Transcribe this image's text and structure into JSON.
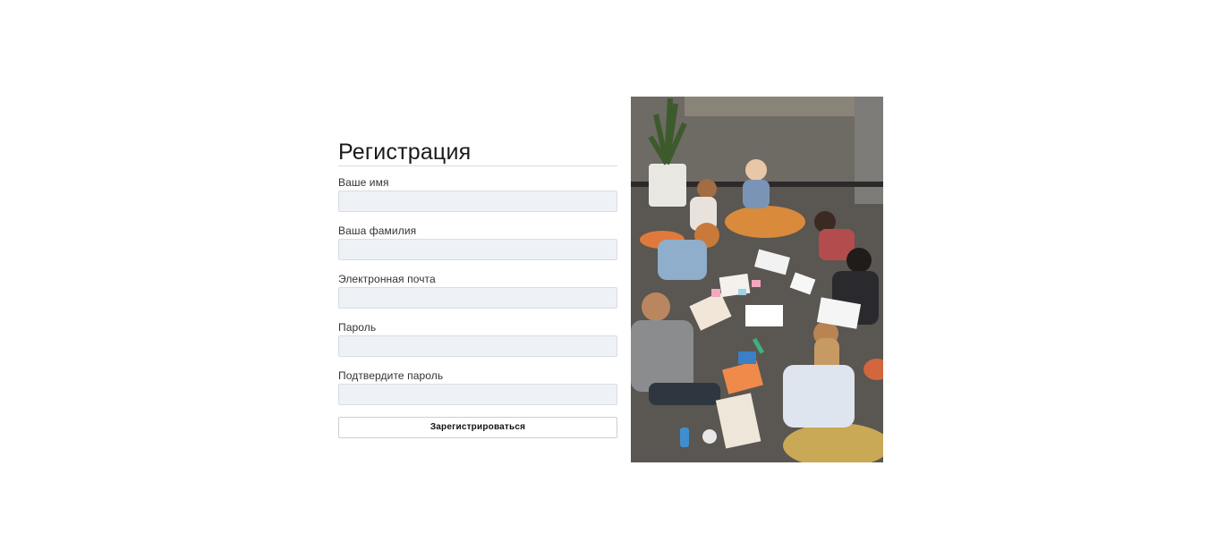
{
  "form": {
    "title": "Регистрация",
    "fields": [
      {
        "label": "Ваше имя",
        "value": "",
        "placeholder": ""
      },
      {
        "label": "Ваша фамилия",
        "value": "",
        "placeholder": ""
      },
      {
        "label": "Электронная почта",
        "value": "",
        "placeholder": ""
      },
      {
        "label": "Пароль",
        "value": "",
        "placeholder": ""
      },
      {
        "label": "Подтвердите пароль",
        "value": "",
        "placeholder": ""
      }
    ],
    "submit_label": "Зарегистрироваться"
  },
  "image": {
    "subject": "group of students sitting on the floor studying with papers and notebooks"
  },
  "colors": {
    "input_bg": "#eef1f6",
    "input_border": "#d8dde4",
    "rule": "#dcdcdc",
    "text": "#1a1a1a"
  }
}
